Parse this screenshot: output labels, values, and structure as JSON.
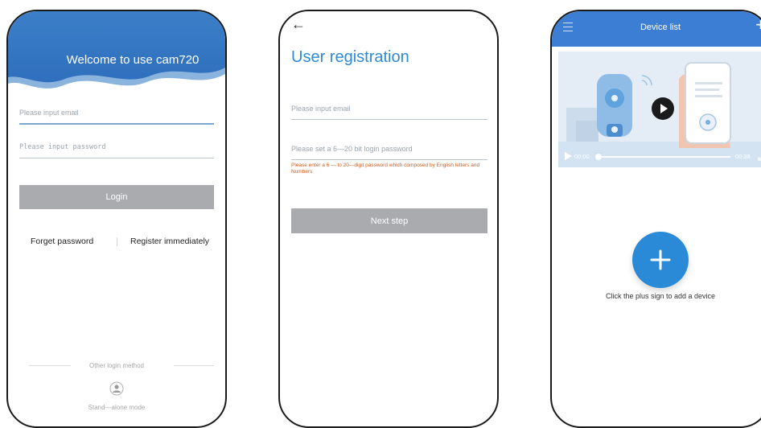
{
  "login_screen": {
    "welcome_title": "Welcome to use cam720",
    "email_placeholder": "Please input email",
    "password_placeholder": "Please input password",
    "login_button": "Login",
    "forget_password": "Forget password",
    "register": "Register immediately",
    "other_login": "Other login method",
    "standalone": "Stand—alone mode"
  },
  "registration_screen": {
    "title": "User registration",
    "email_placeholder": "Please input email",
    "password_placeholder": "Please set a 6—20 bit login password",
    "password_hint": "Please enter a 6 — to 20—digit password which composed by English letters and Numbers",
    "next_button": "Next step"
  },
  "device_list_screen": {
    "title": "Device list",
    "video_elapsed": "00:00",
    "video_duration": "00:38",
    "add_hint": "Click the plus sign to add a device",
    "accent_color": "#3b7ed3"
  }
}
